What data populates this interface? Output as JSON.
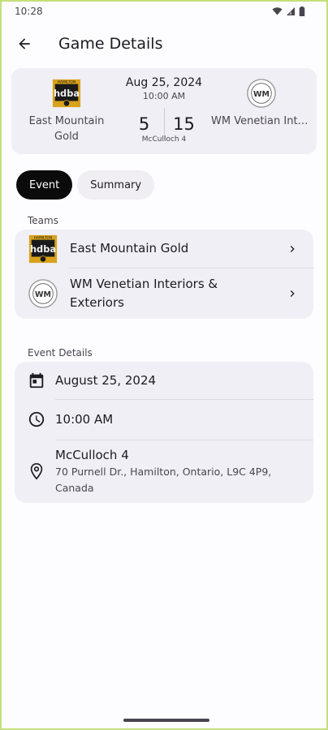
{
  "status_bar": {
    "time": "10:28"
  },
  "app_bar": {
    "title": "Game Details"
  },
  "score_card": {
    "home": {
      "name": "East Mountain Gold",
      "score": "5"
    },
    "away": {
      "name": "WM Venetian Interiors & Exteriors",
      "score": "15"
    },
    "date": "Aug 25, 2024",
    "time": "10:00 AM",
    "rink": "McCulloch 4"
  },
  "tabs": [
    {
      "label": "Event",
      "active": true
    },
    {
      "label": "Summary",
      "active": false
    }
  ],
  "teams_section": {
    "label": "Teams",
    "items": [
      {
        "name": "East Mountain Gold"
      },
      {
        "name": "WM Venetian Interiors & Exteriors"
      }
    ]
  },
  "event_details": {
    "label": "Event Details",
    "date": "August 25, 2024",
    "time": "10:00 AM",
    "location_name": "McCulloch 4",
    "location_address": "70 Purnell Dr., Hamilton, Ontario, L9C 4P9, Canada"
  },
  "logo_text": {
    "hamilton": "HAMILTON",
    "hdba": "hdba",
    "wm": "WM"
  },
  "colors": {
    "accent_dark": "#0b0b0b",
    "card_bg": "#f1eff6",
    "logo_gold": "#d9a21b"
  }
}
